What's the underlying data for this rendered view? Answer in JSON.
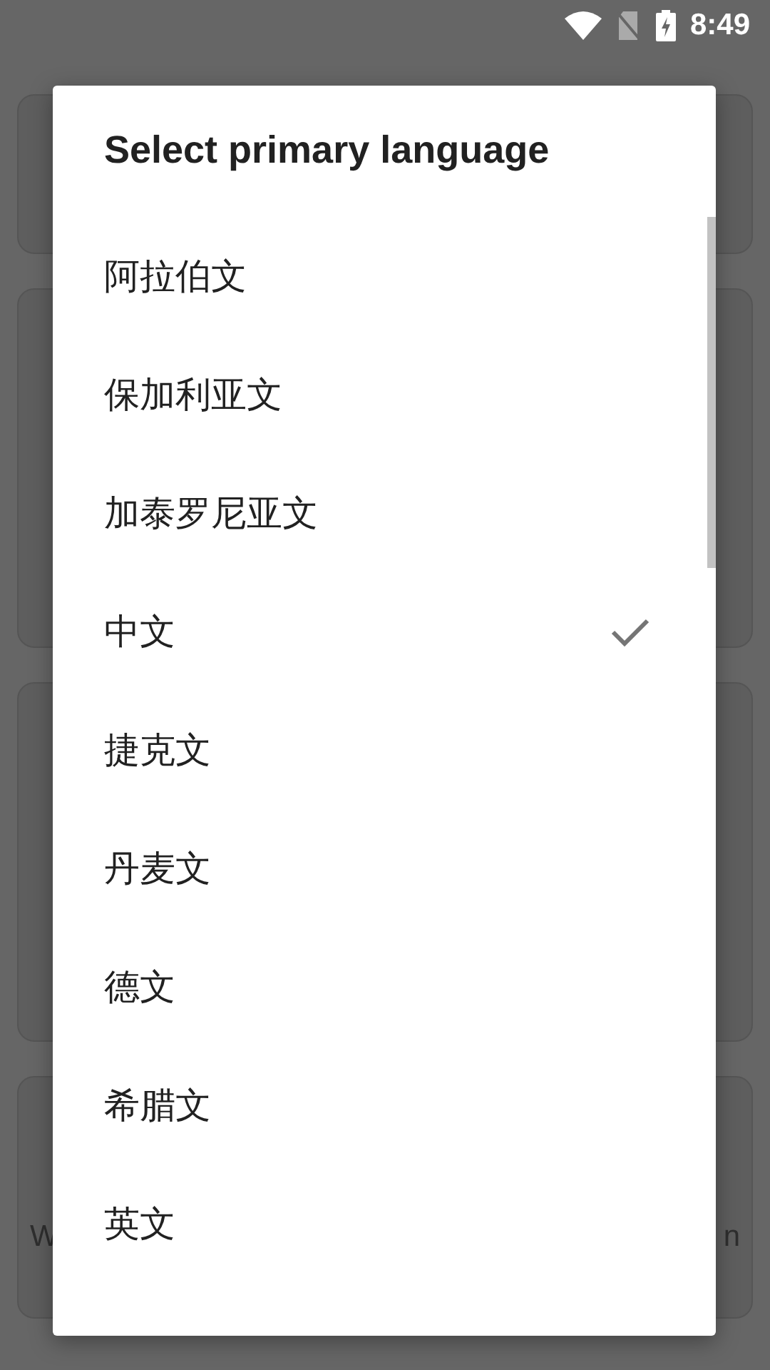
{
  "status_bar": {
    "time": "8:49"
  },
  "background": {
    "labels": [
      "W",
      "n"
    ]
  },
  "dialog": {
    "title": "Select primary language",
    "items": [
      {
        "label": "阿拉伯文",
        "selected": false
      },
      {
        "label": "保加利亚文",
        "selected": false
      },
      {
        "label": "加泰罗尼亚文",
        "selected": false
      },
      {
        "label": "中文",
        "selected": true
      },
      {
        "label": "捷克文",
        "selected": false
      },
      {
        "label": "丹麦文",
        "selected": false
      },
      {
        "label": "德文",
        "selected": false
      },
      {
        "label": "希腊文",
        "selected": false
      },
      {
        "label": "英文",
        "selected": false
      }
    ]
  }
}
